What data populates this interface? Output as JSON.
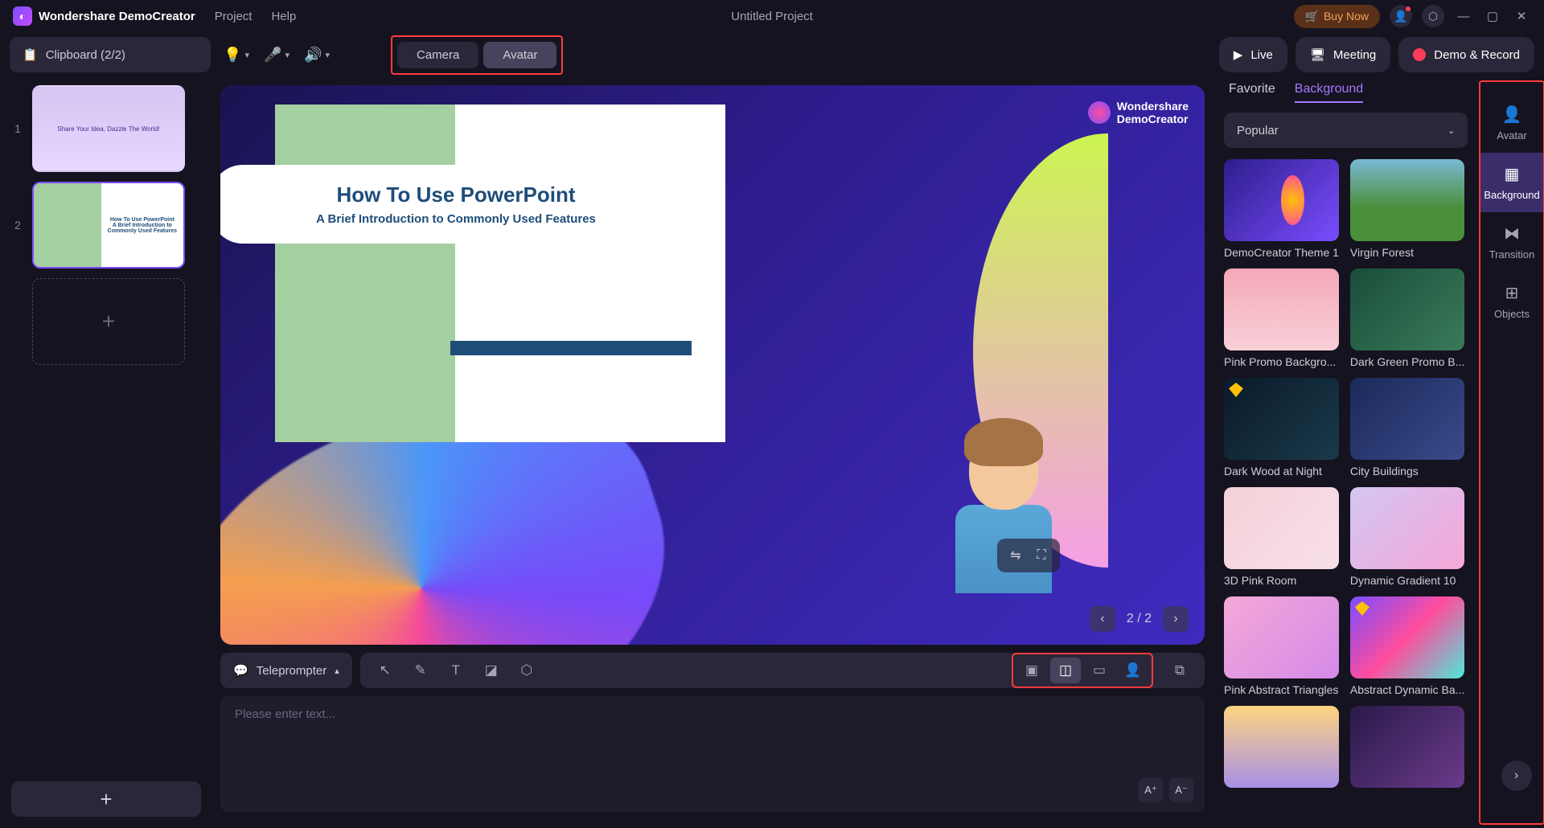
{
  "titlebar": {
    "app_name": "Wondershare DemoCreator",
    "menu": {
      "project": "Project",
      "help": "Help"
    },
    "project_name": "Untitled Project",
    "buy_now": "Buy Now"
  },
  "toolbar": {
    "clipboard": "Clipboard (2/2)",
    "camera": "Camera",
    "avatar": "Avatar",
    "live": "Live",
    "meeting": "Meeting",
    "demo_record": "Demo & Record"
  },
  "slides": {
    "num1": "1",
    "num2": "2",
    "thumb1_text": "Share Your Idea, Dazzle The World!",
    "thumb2_title": "How To Use PowerPoint",
    "thumb2_sub": "A Brief Introduction to Commonly Used Features"
  },
  "canvas": {
    "logo_line1": "Wondershare",
    "logo_line2": "DemoCreator",
    "slide_title": "How To Use PowerPoint",
    "slide_sub": "A Brief Introduction to Commonly Used Features",
    "nav_count": "2 / 2"
  },
  "bottombar": {
    "teleprompter": "Teleprompter",
    "placeholder": "Please enter text...",
    "font_inc": "A⁺",
    "font_dec": "A⁻"
  },
  "panel": {
    "tab_favorite": "Favorite",
    "tab_background": "Background",
    "popular": "Popular",
    "items": [
      "DemoCreator Theme 1",
      "Virgin Forest",
      "Pink Promo Backgro...",
      "Dark Green Promo B...",
      "Dark Wood at Night",
      "City Buildings",
      "3D Pink Room",
      "Dynamic Gradient 10",
      "Pink Abstract Triangles",
      "Abstract Dynamic Ba..."
    ]
  },
  "rail": {
    "avatar": "Avatar",
    "background": "Background",
    "transition": "Transition",
    "objects": "Objects"
  }
}
